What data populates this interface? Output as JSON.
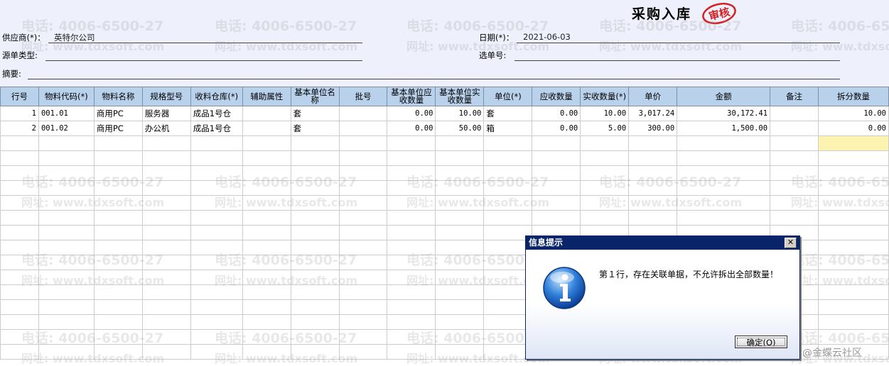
{
  "document": {
    "title": "采购入库",
    "stamp": "审核"
  },
  "header": {
    "supplier_label": "供应商(*)：",
    "supplier_value": "英特尔公司",
    "date_label": "日期(*)：",
    "date_value": "2021-06-03",
    "source_type_label": "源单类型:",
    "source_type_value": "",
    "select_no_label": "选单号:",
    "select_no_value": "",
    "summary_label": "摘要:",
    "summary_value": ""
  },
  "grid": {
    "columns": [
      "行号",
      "物料代码(*)",
      "物料名称",
      "规格型号",
      "收料仓库(*)",
      "辅助属性",
      "基本单位名称",
      "批号",
      "基本单位应收数量",
      "基本单位实收数量",
      "单位(*)",
      "应收数量",
      "实收数量(*)",
      "单价",
      "金额",
      "备注",
      "拆分数量"
    ],
    "rows": [
      [
        "1",
        "001.01",
        "商用PC",
        "服务器",
        "成品1号仓",
        "",
        "套",
        "",
        "0.00",
        "10.00",
        "套",
        "0.00",
        "10.00",
        "3,017.24",
        "30,172.41",
        "",
        "10.00"
      ],
      [
        "2",
        "001.02",
        "商用PC",
        "办公机",
        "成品1号仓",
        "",
        "套",
        "",
        "0.00",
        "50.00",
        "箱",
        "0.00",
        "5.00",
        "300.00",
        "1,500.00",
        "",
        "0.00"
      ]
    ]
  },
  "watermark": {
    "tel": "电话: 4006-6500-27",
    "url": "网址: www.tdxsoft.com"
  },
  "dialog": {
    "title": "信息提示",
    "close": "✕",
    "message": "第１行，存在关联单据，不允许拆出全部数量！",
    "ok_label": "确定(O)"
  },
  "footer": {
    "community": "@金蝶云社区"
  },
  "colors": {
    "header_bg": "#eef1fb",
    "grid_header": "#b9d1ea",
    "dialog_title": "#0a246a",
    "stamp_red": "#d42020",
    "highlight_cell": "#fdf3b0"
  }
}
